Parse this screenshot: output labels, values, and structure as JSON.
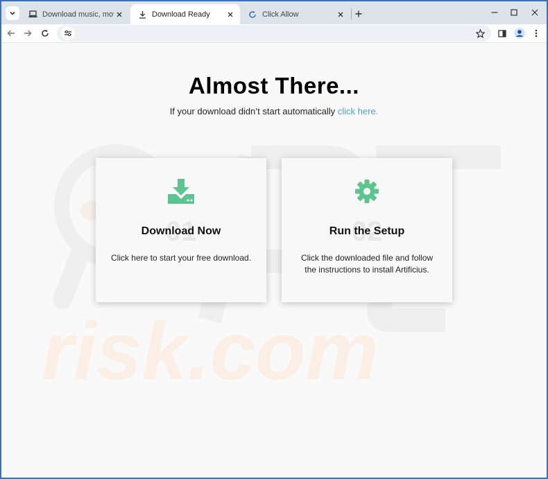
{
  "browser": {
    "tabs": [
      {
        "title": "Download music, movies, game",
        "active": false,
        "favicon": "laptop-icon"
      },
      {
        "title": "Download Ready",
        "active": true,
        "favicon": "download-icon"
      },
      {
        "title": "Click Allow",
        "active": false,
        "favicon": "loading-icon"
      }
    ],
    "address": "",
    "accent": "#3b6fb6"
  },
  "page": {
    "heading": "Almost There...",
    "subtext": "If your download didn’t start automatically ",
    "sublink": "click here.",
    "cards": [
      {
        "number": "01",
        "title": "Download Now",
        "description": "Click here to start your free download.",
        "icon": "download-tray-icon"
      },
      {
        "number": "02",
        "title": "Run the Setup",
        "description": "Click the downloaded file and follow the instructions to install Artificius.",
        "icon": "gear-icon"
      }
    ],
    "icon_color": "#5ec48f",
    "link_color": "#4a9fd0",
    "watermark": "risk.com"
  }
}
